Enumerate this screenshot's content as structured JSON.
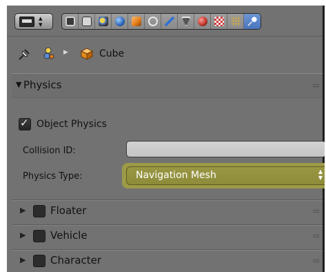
{
  "toolbar": {
    "editor_icon": "properties-editor-icon",
    "context_icons": [
      "render-icon",
      "render-layers-icon",
      "scene-icon",
      "world-icon",
      "object-icon",
      "constraints-icon",
      "modifiers-icon",
      "data-icon",
      "material-icon",
      "texture-icon",
      "particles-icon",
      "physics-icon"
    ],
    "active_context": "physics-icon"
  },
  "breadcrumb": {
    "object_label": "Cube"
  },
  "physics_panel": {
    "title": "Physics",
    "object_physics_label": "Object Physics",
    "object_physics_checked": true,
    "collision_id_label": "Collision ID:",
    "collision_id_value": "",
    "physics_type_label": "Physics Type:",
    "physics_type_value": "Navigation Mesh"
  },
  "collapsed_panels": [
    {
      "label": "Floater",
      "enabled": false
    },
    {
      "label": "Vehicle",
      "enabled": false
    },
    {
      "label": "Character",
      "enabled": false
    }
  ],
  "colors": {
    "panel_bg": "#727272",
    "highlight": "#9c9a48",
    "active_tab": "#5b85c8"
  }
}
